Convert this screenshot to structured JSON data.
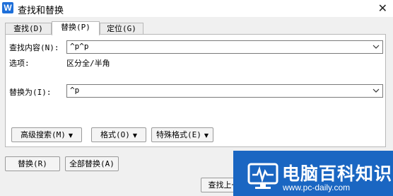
{
  "window": {
    "title": "查找和替换",
    "icon_letter": "W",
    "close_glyph": "✕"
  },
  "tabs": [
    {
      "label": "查找(D)",
      "active": false
    },
    {
      "label": "替换(P)",
      "active": true
    },
    {
      "label": "定位(G)",
      "active": false
    }
  ],
  "find": {
    "label": "查找内容(N):",
    "value": "^p^p"
  },
  "options": {
    "label": "选项:",
    "value": "区分全/半角"
  },
  "replace": {
    "label": "替换为(I):",
    "value": "^p"
  },
  "format_buttons": {
    "advanced_search": "高级搜索(M)",
    "format": "格式(O)",
    "special_format": "特殊格式(E)"
  },
  "actions": {
    "replace": "替换(R)",
    "replace_all": "全部替换(A)",
    "find_previous": "查找上一处"
  },
  "watermark": {
    "title": "电脑百科知识",
    "url": "www.pc-daily.com",
    "bg_color": "#1a66c2"
  }
}
